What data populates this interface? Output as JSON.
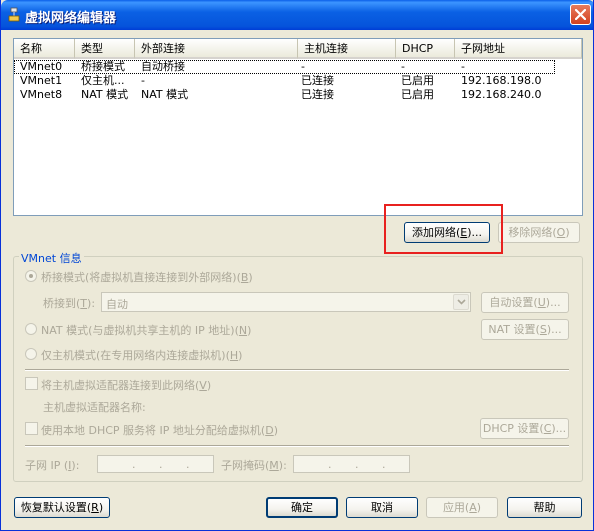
{
  "window": {
    "title": "虚拟网络编辑器"
  },
  "table": {
    "columns": [
      "名称",
      "类型",
      "外部连接",
      "主机连接",
      "DHCP",
      "子网地址"
    ],
    "rows": [
      [
        "VMnet0",
        "桥接模式",
        "自动桥接",
        "-",
        "-",
        "-"
      ],
      [
        "VMnet1",
        "仅主机...",
        "-",
        "已连接",
        "已启用",
        "192.168.198.0"
      ],
      [
        "VMnet8",
        "NAT 模式",
        "NAT 模式",
        "已连接",
        "已启用",
        "192.168.240.0"
      ]
    ]
  },
  "actions": {
    "add_network_prefix": "添加网络(",
    "add_network_key": "E",
    "add_network_suffix": ")...",
    "remove_network_prefix": "移除网络(",
    "remove_network_key": "O",
    "remove_network_suffix": ")"
  },
  "vmnet_info": {
    "title": "VMnet 信息",
    "bridged_prefix": "桥接模式(将虚拟机直接连接到外部网络)(",
    "bridged_key": "B",
    "bridged_suffix": ")",
    "bridged_to_prefix": "桥接到(",
    "bridged_to_key": "T",
    "bridged_to_suffix": "):",
    "bridged_to_value": "自动",
    "auto_settings_prefix": "自动设置(",
    "auto_settings_key": "U",
    "auto_settings_suffix": ")...",
    "nat_prefix": "NAT 模式(与虚拟机共享主机的 IP 地址)(",
    "nat_key": "N",
    "nat_suffix": ")",
    "nat_settings_prefix": "NAT 设置(",
    "nat_settings_key": "S",
    "nat_settings_suffix": ")...",
    "host_only_prefix": "仅主机模式(在专用网络内连接虚拟机)(",
    "host_only_key": "H",
    "host_only_suffix": ")",
    "connect_adapter_prefix": "将主机虚拟适配器连接到此网络(",
    "connect_adapter_key": "V",
    "connect_adapter_suffix": ")",
    "adapter_name_label": "主机虚拟适配器名称:",
    "use_dhcp_prefix": "使用本地 DHCP 服务将 IP 地址分配给虚拟机(",
    "use_dhcp_key": "D",
    "use_dhcp_suffix": ")",
    "dhcp_settings_prefix": "DHCP 设置(",
    "dhcp_settings_key": "C",
    "dhcp_settings_suffix": ")...",
    "subnet_ip_prefix": "子网 IP (",
    "subnet_ip_key": "I",
    "subnet_ip_suffix": "):",
    "subnet_mask_prefix": "子网掩码(",
    "subnet_mask_key": "M",
    "subnet_mask_suffix": "):",
    "ip_dots": ".",
    "mask_dots": "."
  },
  "footer": {
    "restore_prefix": "恢复默认设置(",
    "restore_key": "R",
    "restore_suffix": ")",
    "ok": "确定",
    "cancel": "取消",
    "apply_prefix": "应用(",
    "apply_key": "A",
    "apply_suffix": ")",
    "help": "帮助"
  },
  "colors": {
    "title_bar": "#0b61e4",
    "highlight_box": "#e8211f",
    "group_title": "#0046d5",
    "disabled_text": "#aca899"
  }
}
